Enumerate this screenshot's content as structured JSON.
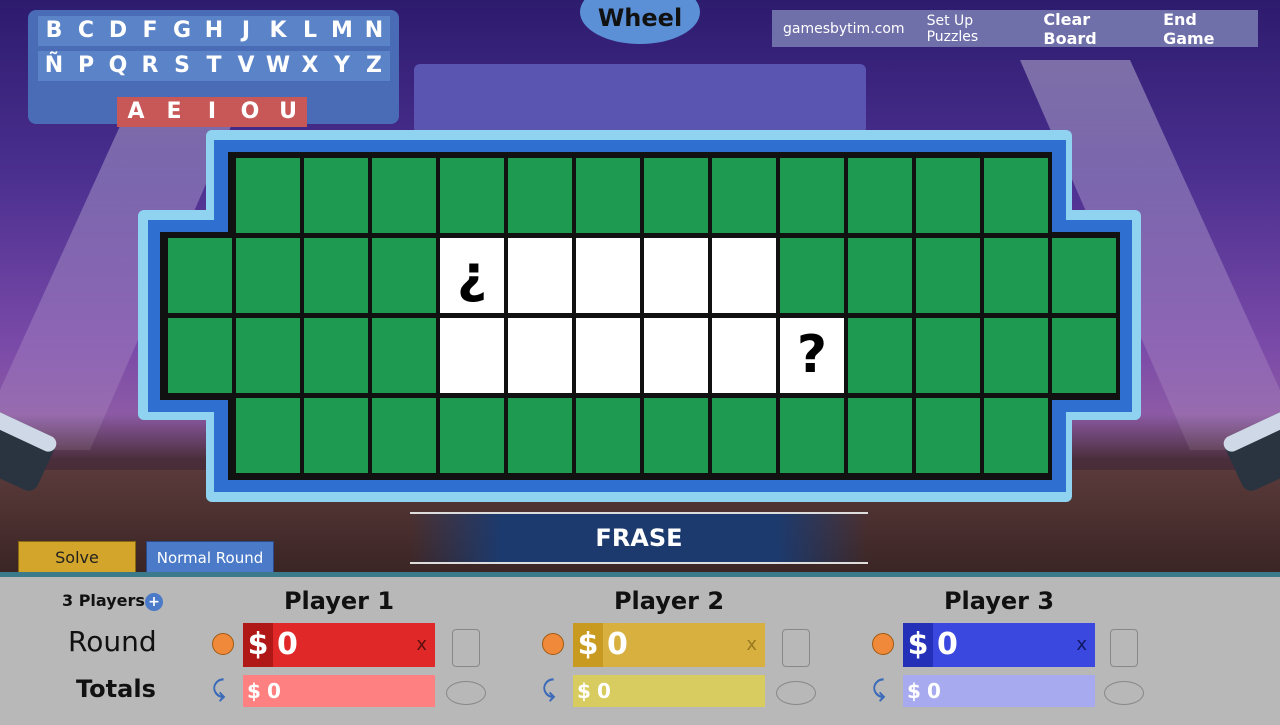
{
  "header": {
    "wheel_label": "Wheel"
  },
  "menu": {
    "items": [
      "gamesbytim.com",
      "Set Up Puzzles",
      "Clear Board",
      "End Game"
    ]
  },
  "letters": {
    "row1": [
      "B",
      "C",
      "D",
      "F",
      "G",
      "H",
      "J",
      "K",
      "L",
      "M",
      "N"
    ],
    "row2": [
      "Ñ",
      "P",
      "Q",
      "R",
      "S",
      "T",
      "V",
      "W",
      "X",
      "Y",
      "Z"
    ],
    "vowels": [
      "A",
      "E",
      "I",
      "O",
      "U"
    ]
  },
  "board": {
    "row2_open_symbol": "¿",
    "row3_close_symbol": "?"
  },
  "category": "FRASE",
  "buttons": {
    "solve": "Solve",
    "round_type": "Normal Round"
  },
  "panel": {
    "player_count": "3 Players",
    "add_symbol": "+",
    "round_label": "Round",
    "totals_label": "Totals"
  },
  "players": [
    {
      "name": "Player 1",
      "currency": "$",
      "round": "0",
      "total": "0",
      "x": "x",
      "color": "#e02828",
      "tcolor": "#ff8080",
      "dcolor": "#b01818"
    },
    {
      "name": "Player 2",
      "currency": "$",
      "round": "0",
      "total": "0",
      "x": "x",
      "color": "#d8b040",
      "tcolor": "#d8cc60",
      "dcolor": "#c89a20"
    },
    {
      "name": "Player 3",
      "currency": "$",
      "round": "0",
      "total": "0",
      "x": "x",
      "color": "#3a48e0",
      "tcolor": "#a8aaf0",
      "dcolor": "#2430b8"
    }
  ],
  "colors": {
    "tile": "#1e9b50",
    "frame_light": "#8fd3f0",
    "frame_dark": "#2e6fd0"
  }
}
